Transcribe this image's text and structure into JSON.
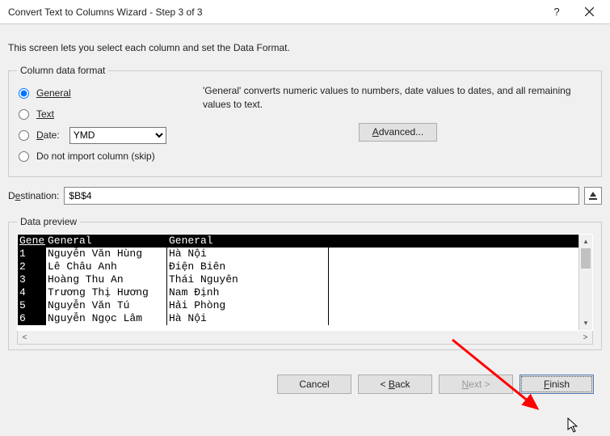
{
  "titlebar": {
    "title": "Convert Text to Columns Wizard - Step 3 of 3"
  },
  "intro": "This screen lets you select each column and set the Data Format.",
  "group_format": {
    "legend": "Column data format",
    "opt_general": "General",
    "opt_text": "Text",
    "opt_date_label": "Date:",
    "date_value": "YMD",
    "opt_skip": "Do not import column (skip)",
    "desc": "'General' converts numeric values to numbers, date values to dates, and all remaining values to text.",
    "advanced_label": "Advanced..."
  },
  "destination": {
    "label": "Destination:",
    "value": "$B$4"
  },
  "preview": {
    "legend": "Data preview",
    "headers": [
      "General",
      "General",
      "General"
    ],
    "rows": [
      [
        "1",
        "Nguyễn Văn Hùng",
        "Hà Nội"
      ],
      [
        "2",
        "Lê Châu Anh",
        "Điện Biên"
      ],
      [
        "3",
        "Hoàng Thu An",
        "Thái Nguyên"
      ],
      [
        "4",
        "Trương Thị Hương",
        "Nam Định"
      ],
      [
        "5",
        "Nguyễn Văn Tú",
        "Hải Phòng"
      ],
      [
        "6",
        "Nguyễn Ngọc Lâm",
        "Hà Nội"
      ]
    ]
  },
  "footer": {
    "cancel": "Cancel",
    "back": "< Back",
    "next": "Next >",
    "finish": "Finish"
  }
}
